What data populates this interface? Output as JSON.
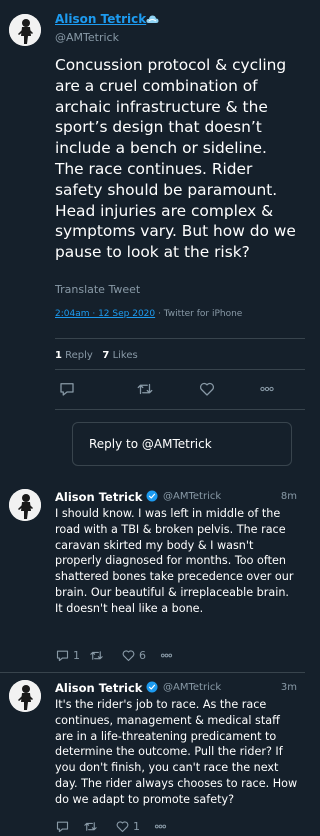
{
  "main_tweet": {
    "author_name": "Alison Tetrick",
    "handle": "@AMTetrick",
    "text": "Concussion protocol & cycling are a cruel combination of archaic infrastructure & the sport’s design that doesn’t include a bench or sideline. The race continues. Rider safety should be paramount. Head injuries are complex & symptoms vary. But how do we pause to look at the risk?",
    "translate_label": "Translate Tweet",
    "timestamp": "2:04am · 12 Sep 2020",
    "source": " · Twitter for iPhone",
    "reply_count": "1",
    "reply_label": "Reply",
    "like_count": "7",
    "like_label": "Likes",
    "icons": [
      "reply-icon",
      "retweet-icon",
      "like-icon",
      "more-icon"
    ]
  },
  "reply_box": {
    "placeholder": "Reply to @AMTetrick"
  },
  "replies": [
    {
      "author_name": "Alison Tetrick",
      "handle": "@AMTetrick",
      "time": "8m",
      "text": "I should know. I was left in middle of the road with a TBI & broken pelvis. The race caravan skirted my body & I wasn't properly diagnosed for months. Too often shattered bones take precedence over our brain. Our beautiful & irreplaceable brain. It doesn't heal like a bone.",
      "reply_count": "1",
      "retweet_count": "",
      "like_count": "6"
    },
    {
      "author_name": "Alison Tetrick",
      "handle": "@AMTetrick",
      "time": "3m",
      "text": "It's the rider's job to race. As the race continues, management & medical staff are in a life-threatening predicament to determine the outcome. Pull the rider? If you don't finish, you can't race the next day. The rider always chooses to race. How do we adapt to promote safety?",
      "reply_count": "",
      "retweet_count": "",
      "like_count": "1"
    }
  ],
  "colors": {
    "background": "#15202b",
    "accent": "#1d9bf0",
    "muted": "#8899a6",
    "divider": "#38444d",
    "verified": "#1d9bf0"
  }
}
